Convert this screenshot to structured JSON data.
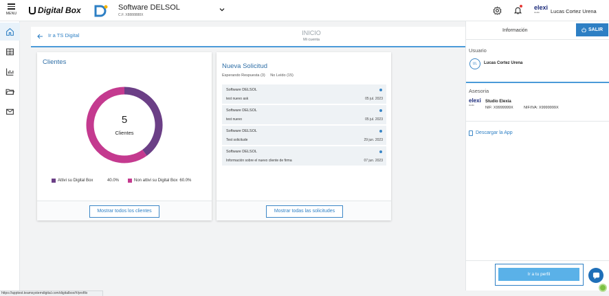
{
  "topbar": {
    "menu_label": "MENU",
    "brand": "Digital Box",
    "app_name": "Software DELSOL",
    "app_cf": "C.F. X8888888X",
    "user_logo": "elexi",
    "user_logo_sub": "studio",
    "user_name": "Lucas Cortez Urena"
  },
  "rail": {
    "items": [
      {
        "icon": "home-icon",
        "active": true
      },
      {
        "icon": "archive-icon",
        "active": false
      },
      {
        "icon": "chart-icon",
        "active": false
      },
      {
        "icon": "folder-icon",
        "active": false
      },
      {
        "icon": "mail-icon",
        "active": false
      }
    ]
  },
  "subheader": {
    "back_label": "Ir a TS Digital",
    "title": "INICIO",
    "subtitle": "Mi cuenta"
  },
  "clients": {
    "title": "Clientes",
    "total": "5",
    "total_label": "Clientes",
    "legend": [
      {
        "label": "Attivi su Digital Box",
        "value": "40.0%",
        "color": "#6b3f86"
      },
      {
        "label": "Non attivi su Digital Box",
        "value": "60.0%",
        "color": "#c43a8f"
      }
    ],
    "button": "Mostrar todos los clientes"
  },
  "chart_data": {
    "type": "pie",
    "categories": [
      "Attivi su Digital Box",
      "Non attivi su Digital Box"
    ],
    "values": [
      40.0,
      60.0
    ],
    "colors": [
      "#6b3f86",
      "#c43a8f"
    ],
    "title": "Clientes",
    "center_value": "5",
    "center_label": "Clientes"
  },
  "requests": {
    "title": "Nueva Solicitud",
    "tab_waiting": "Esperando Respuesta (3)",
    "tab_unread": "No Leído (15)",
    "items": [
      {
        "title": "Software DELSOL",
        "subject": "test nuevo ask",
        "date": "05 jul. 2023"
      },
      {
        "title": "Software DELSOL",
        "subject": "test nuevo",
        "date": "05 jul. 2023"
      },
      {
        "title": "Software DELSOL",
        "subject": "Test solicitude",
        "date": "29 jun. 2023"
      },
      {
        "title": "Software DELSOL",
        "subject": "Información sobre el nuevo cliente de firma",
        "date": "07 jun. 2023"
      }
    ],
    "button": "Mostrar todas las solicitudes"
  },
  "panel": {
    "title": "Información",
    "logout": "SALIR",
    "user_section": "Usuario",
    "user_initials": "UL",
    "user_name": "Lucas Cortez Urena",
    "advisory_section": "Asesoria",
    "advisory_logo": "elexi",
    "advisory_logo_sub": "studio",
    "advisory_name": "Studio Elexia",
    "nif": "NIF: X9999999X",
    "nif_iva": "NIF/IVA: X9999999X",
    "download": "Descargar la App",
    "profile_button": "Ir a tu perfil"
  },
  "statusbar": {
    "url": "https://apptest.teamsystemdigital.com/digitalbox/#/profilo"
  }
}
